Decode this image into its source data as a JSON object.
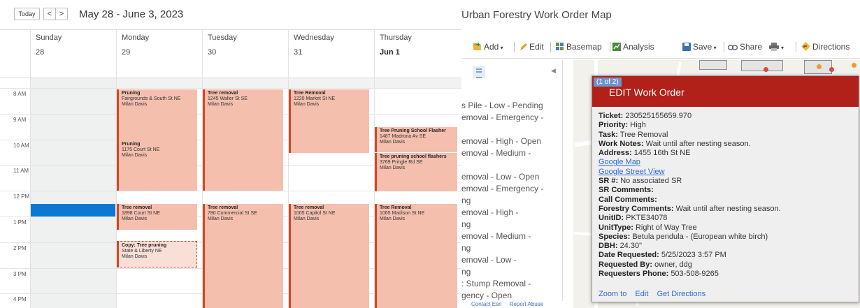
{
  "calendar": {
    "today_label": "Today",
    "prev_label": "<",
    "next_label": ">",
    "date_range": "May 28 - June 3, 2023",
    "days": [
      {
        "dow": "Sunday",
        "num": "28"
      },
      {
        "dow": "Monday",
        "num": "29"
      },
      {
        "dow": "Tuesday",
        "num": "30"
      },
      {
        "dow": "Wednesday",
        "num": "31"
      },
      {
        "dow": "Thursday",
        "num": "Jun 1"
      }
    ],
    "hours": [
      "8 AM",
      "9 AM",
      "10 AM",
      "11 AM",
      "12 PM",
      "1 PM",
      "2 PM",
      "3 PM",
      "4 PM"
    ],
    "events": [
      {
        "title": "Pruning",
        "addr": "Fairgrounds & South St NE",
        "person": "Milan Davis"
      },
      {
        "title": "Pruning",
        "addr": "1175 Court St NE",
        "person": "Milan Davis"
      },
      {
        "title": "Tree removal",
        "addr": "1898 Court St NE",
        "person": "Milan Davis"
      },
      {
        "title": "Copy: Tree pruning",
        "addr": "State & Liberty NE",
        "person": "Milan Davis"
      },
      {
        "title": "Tree removal",
        "addr": "1245 Waller St SE",
        "person": "Milan Davis"
      },
      {
        "title": "Tree removal",
        "addr": "780 Commercial St SE",
        "person": "Milan Davis"
      },
      {
        "title": "Tree Removal",
        "addr": "1220 Market St NE",
        "person": "Milan Davis"
      },
      {
        "title": "Tree removal",
        "addr": "1005 Capitol St NE",
        "person": "Milan Davis"
      },
      {
        "title": "Tree Pruning School Flasher",
        "addr": "1487 Madrona Av SE",
        "person": "Milan Davis"
      },
      {
        "title": "Tree pruning school flashers",
        "addr": "3769 Pringle Rd SE",
        "person": "Milan Davis"
      },
      {
        "title": "Tree Removal",
        "addr": "1065 Madison St NE",
        "person": "Milan Davis"
      }
    ],
    "colors": {
      "event_fill": "#f5bfae",
      "event_border": "#d9451f",
      "selection": "#0b78d4"
    }
  },
  "map_app": {
    "title": "Urban Forestry Work Order Map",
    "toolbar": {
      "add": "Add",
      "edit": "Edit",
      "basemap": "Basemap",
      "analysis": "Analysis",
      "save": "Save",
      "share": "Share",
      "directions": "Directions"
    },
    "layers": [
      "s Pile - Low - Pending",
      "emoval - Emergency -",
      "",
      "emoval - High - Open",
      "emoval - Medium -",
      "",
      "emoval - Low - Open",
      "emoval - Emergency -",
      "ng",
      "emoval - High -",
      "ng",
      "emoval - Medium -",
      "ng",
      "emoval - Low -",
      "ng",
      ": Stump Removal -",
      "gency - Open",
      "Stump Removal"
    ],
    "attribution": {
      "contact": "Contact Esri",
      "report": "Report Abuse"
    },
    "popup": {
      "count": "(1 of 2)",
      "header": "EDIT Work Order",
      "fields": [
        {
          "label": "Ticket:",
          "value": "230525155659.970"
        },
        {
          "label": "Priority:",
          "value": "High"
        },
        {
          "label": "Task:",
          "value": "Tree Removal"
        },
        {
          "label": "Work Notes:",
          "value": "Wait until after nesting season."
        },
        {
          "label": "Address:",
          "value": "1455 16th St NE"
        }
      ],
      "links": {
        "google_map": "Google Map",
        "street_view": "Google Street View"
      },
      "fields2": [
        {
          "label": "SR #:",
          "value": "No associated SR"
        },
        {
          "label": "SR Comments:",
          "value": ""
        },
        {
          "label": "Call Comments:",
          "value": ""
        },
        {
          "label": "Forestry Comments:",
          "value": "Wait until after nesting season."
        },
        {
          "label": "UnitID:",
          "value": "PKTE34078"
        },
        {
          "label": "UnitType:",
          "value": "Right of Way Tree"
        },
        {
          "label": "Species:",
          "value": "Betula pendula - (European white birch)"
        },
        {
          "label": "DBH:",
          "value": "24.30\""
        },
        {
          "label": "Date Requested:",
          "value": "5/25/2023 3:57 PM"
        },
        {
          "label": "Requested By:",
          "value": "owner, ddg"
        },
        {
          "label": "Requesters Phone:",
          "value": "503-508-9265"
        }
      ],
      "actions": {
        "zoom": "Zoom to",
        "edit": "Edit",
        "directions": "Get Directions"
      },
      "header_color": "#b2201a"
    }
  }
}
